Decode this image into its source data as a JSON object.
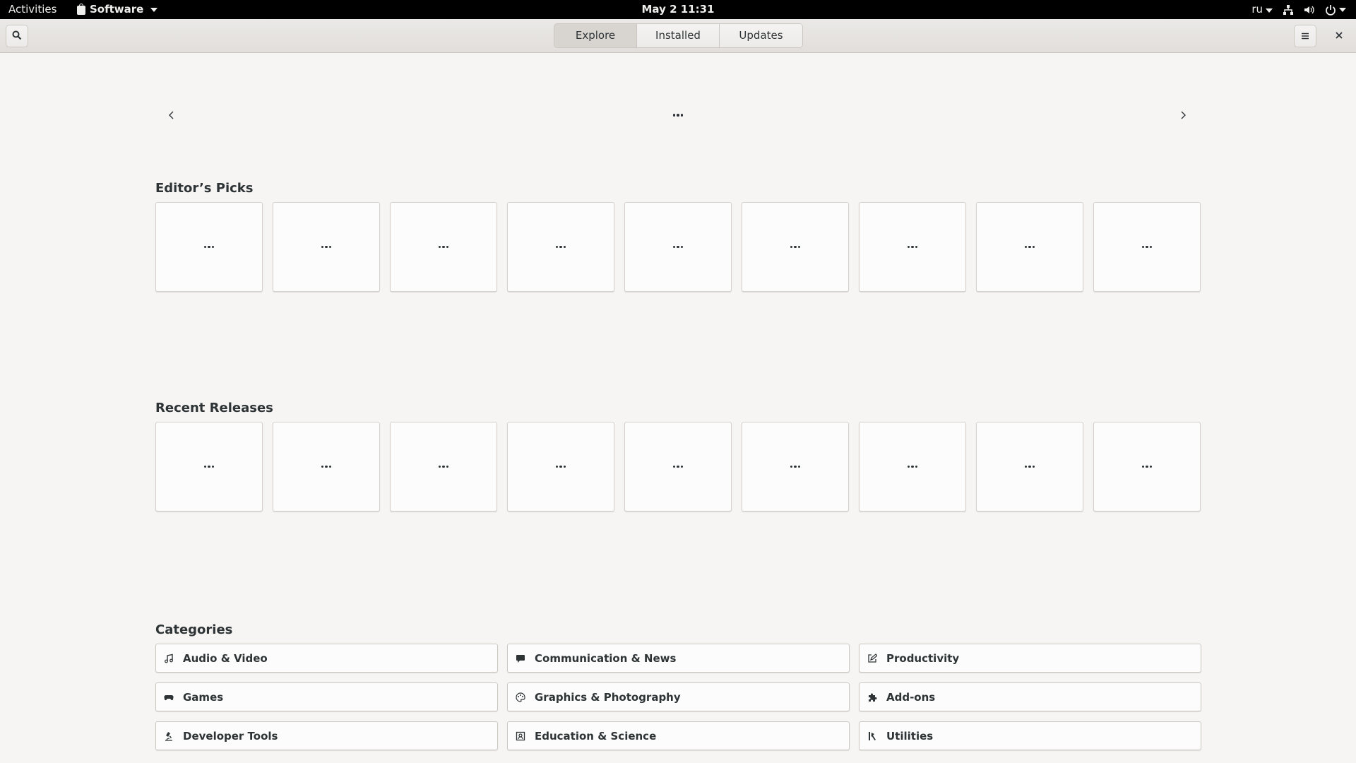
{
  "topbar": {
    "activities": "Activities",
    "app_name": "Software",
    "clock": "May 2  11:31",
    "keyboard_layout": "ru",
    "icons": [
      "network-icon",
      "volume-icon",
      "power-icon"
    ]
  },
  "header": {
    "tabs": [
      {
        "label": "Explore",
        "active": true
      },
      {
        "label": "Installed",
        "active": false
      },
      {
        "label": "Updates",
        "active": false
      }
    ],
    "icons": [
      "search-icon",
      "hamburger-menu-icon",
      "close-icon"
    ]
  },
  "carousel": {
    "icons": [
      "chevron-left-icon",
      "loading-dots-icon",
      "chevron-right-icon"
    ]
  },
  "editors_picks": {
    "title": "Editor’s Picks",
    "tile_count": 9
  },
  "recent_releases": {
    "title": "Recent Releases",
    "tile_count": 9
  },
  "categories": {
    "title": "Categories",
    "items": [
      {
        "label": "Audio & Video",
        "icon": "music-note-icon"
      },
      {
        "label": "Communication & News",
        "icon": "chat-bubble-icon"
      },
      {
        "label": "Productivity",
        "icon": "edit-icon"
      },
      {
        "label": "Games",
        "icon": "gamepad-icon"
      },
      {
        "label": "Graphics & Photography",
        "icon": "palette-icon"
      },
      {
        "label": "Add-ons",
        "icon": "puzzle-icon"
      },
      {
        "label": "Developer Tools",
        "icon": "microscope-icon"
      },
      {
        "label": "Education & Science",
        "icon": "education-icon"
      },
      {
        "label": "Utilities",
        "icon": "tools-icon"
      }
    ]
  }
}
